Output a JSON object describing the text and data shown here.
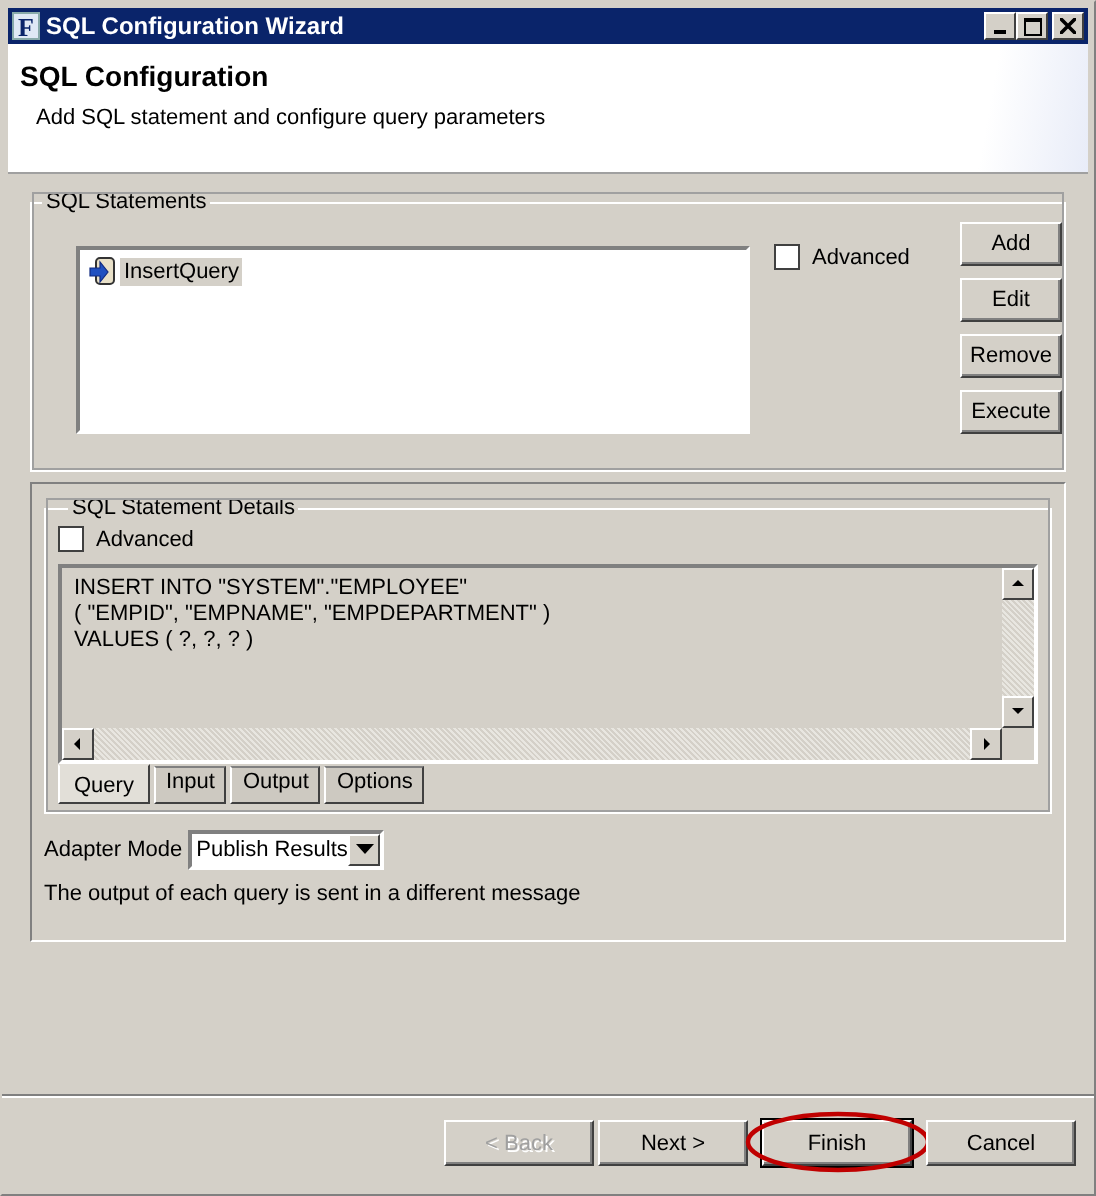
{
  "window": {
    "title": "SQL Configuration Wizard",
    "icon_letter": "F"
  },
  "header": {
    "title": "SQL Configuration",
    "subtitle": "Add SQL statement and configure query parameters"
  },
  "sql_statements": {
    "label": "SQL Statements",
    "items": [
      {
        "label": "InsertQuery",
        "selected": true
      }
    ],
    "advanced": {
      "label": "Advanced",
      "checked": false
    },
    "buttons": [
      "Add",
      "Edit",
      "Remove",
      "Execute"
    ]
  },
  "details": {
    "label": "SQL Statement Details",
    "advanced": {
      "label": "Advanced",
      "checked": false
    },
    "sql_lines": [
      "INSERT INTO \"SYSTEM\".\"EMPLOYEE\"",
      "( \"EMPID\", \"EMPNAME\", \"EMPDEPARTMENT\" )",
      "VALUES ( ?, ?, ? )"
    ],
    "tabs": [
      {
        "label": "Query",
        "selected": true
      },
      {
        "label": "Input",
        "selected": false
      },
      {
        "label": "Output",
        "selected": false
      },
      {
        "label": "Options",
        "selected": false
      }
    ]
  },
  "adapter_mode": {
    "label": "Adapter Mode",
    "value": "Publish Results"
  },
  "note": "The output of each query is sent in a different message",
  "footer_buttons": [
    {
      "label": "< Back",
      "disabled": true,
      "circled": false
    },
    {
      "label": "Next >",
      "disabled": false,
      "circled": false
    },
    {
      "label": "Finish",
      "disabled": false,
      "circled": true
    },
    {
      "label": "Cancel",
      "disabled": false,
      "circled": false
    }
  ]
}
